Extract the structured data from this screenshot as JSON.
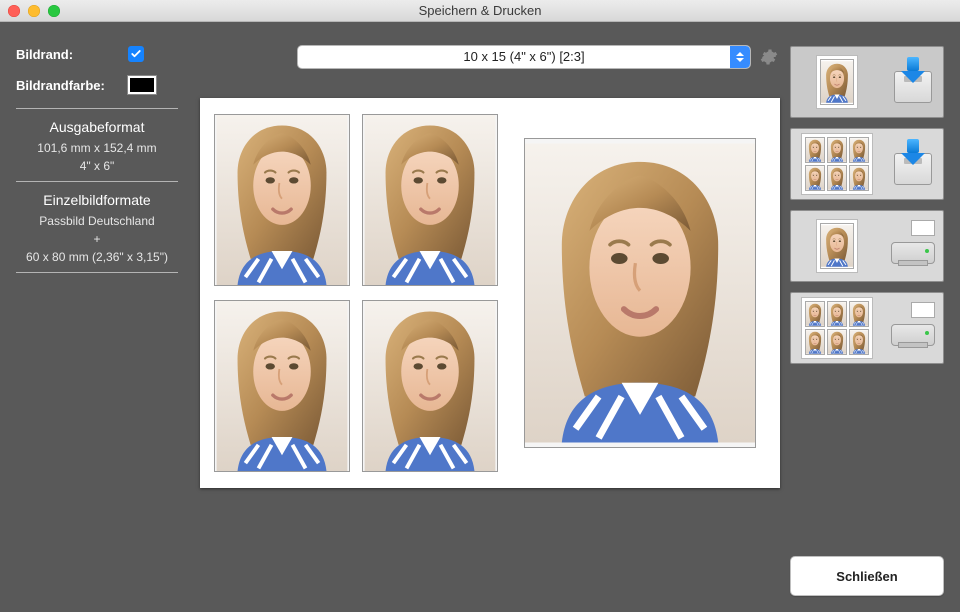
{
  "window": {
    "title": "Speichern & Drucken"
  },
  "left": {
    "border_label": "Bildrand:",
    "border_checked": true,
    "bordercolor_label": "Bildrandfarbe:",
    "bordercolor": "#000000",
    "section_output": {
      "head": "Ausgabeformat",
      "line1": "101,6 mm x 152,4 mm",
      "line2": "4\" x 6\""
    },
    "section_single": {
      "head": "Einzelbildformate",
      "line1": "Passbild Deutschland",
      "plus": "+",
      "line2": "60 x 80 mm (2,36\" x 3,15\")"
    }
  },
  "paper_select": {
    "selected": "10 x 15 (4\" x 6\") [2:3]"
  },
  "actions": {
    "save_single": "save-single-image",
    "save_sheet": "save-sheet-image",
    "print_single": "print-single-image",
    "print_sheet": "print-sheet-image"
  },
  "buttons": {
    "close": "Schließen"
  }
}
